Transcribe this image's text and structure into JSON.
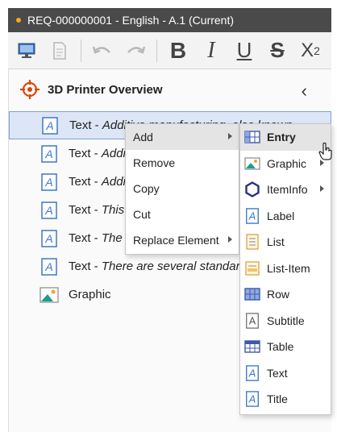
{
  "window": {
    "title": "REQ-000000001 - English - A.1 (Current)",
    "accent": "#f5a623"
  },
  "toolbar": {
    "icons": [
      "monitor-icon",
      "document-icon",
      "undo-icon",
      "redo-icon",
      "bold-icon",
      "italic-icon",
      "underline-icon",
      "strikethrough-icon",
      "subscript-icon"
    ],
    "bold": "B",
    "italic": "I",
    "underline": "U",
    "strike": "S",
    "sub_main": "X",
    "sub_digit": "2"
  },
  "panel": {
    "title": "3D Printer Overview",
    "rows": [
      {
        "type": "Text -",
        "text": "Additive manufacturing, also known"
      },
      {
        "type": "Text -",
        "text": "Addi"
      },
      {
        "type": "Text -",
        "text": "Addi"
      },
      {
        "type": "Text -",
        "text": "This"
      },
      {
        "type": "Text -",
        "text": "The"
      },
      {
        "type": "Text -",
        "text": "There are several standard"
      },
      {
        "type": "Graphic",
        "text": ""
      }
    ]
  },
  "context_menu": {
    "items": [
      {
        "label": "Add",
        "submenu": true
      },
      {
        "label": "Remove",
        "submenu": false
      },
      {
        "label": "Copy",
        "submenu": false
      },
      {
        "label": "Cut",
        "submenu": false
      },
      {
        "label": "Replace Element",
        "submenu": true
      }
    ]
  },
  "add_submenu": {
    "items": [
      {
        "label": "Entry",
        "icon": "entry-grid-icon",
        "submenu": false
      },
      {
        "label": "Graphic",
        "icon": "graphic-icon",
        "submenu": true
      },
      {
        "label": "ItemInfo",
        "icon": "hexagon-icon",
        "submenu": true
      },
      {
        "label": "Label",
        "icon": "text-a-icon",
        "submenu": false
      },
      {
        "label": "List",
        "icon": "list-icon",
        "submenu": false
      },
      {
        "label": "List-Item",
        "icon": "list-item-icon",
        "submenu": false
      },
      {
        "label": "Row",
        "icon": "row-grid-icon",
        "submenu": false
      },
      {
        "label": "Subtitle",
        "icon": "subtitle-a-icon",
        "submenu": false
      },
      {
        "label": "Table",
        "icon": "table-icon",
        "submenu": false
      },
      {
        "label": "Text",
        "icon": "text-a-icon",
        "submenu": false
      },
      {
        "label": "Title",
        "icon": "text-a-icon",
        "submenu": false
      }
    ]
  }
}
